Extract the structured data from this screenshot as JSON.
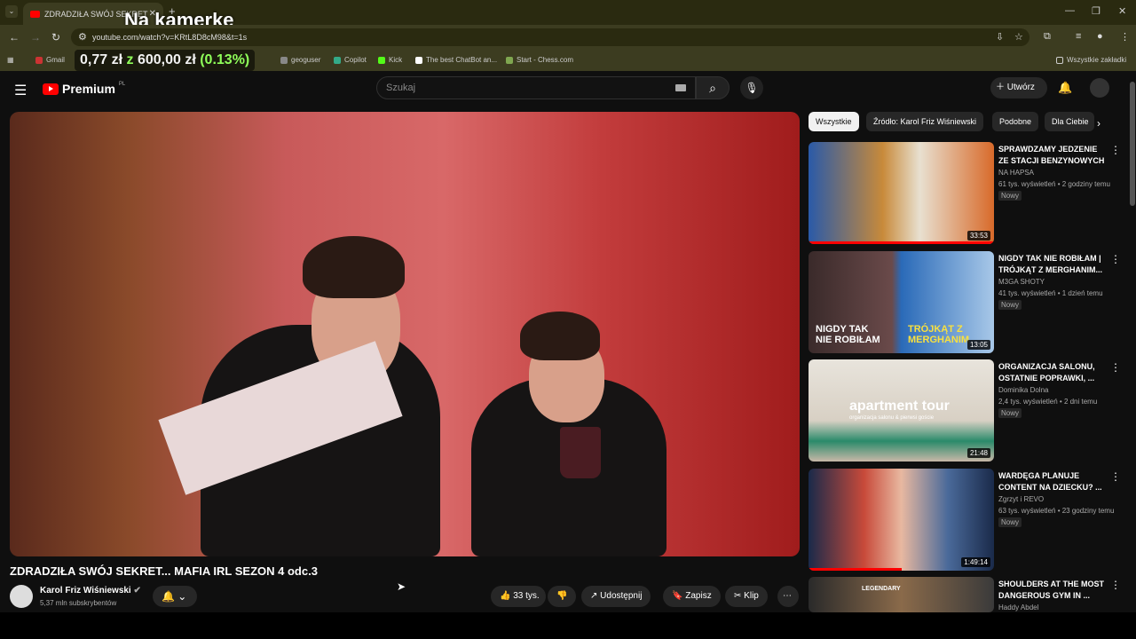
{
  "browser": {
    "tab_title": "ZDRADZIŁA SWÓJ SEKRET",
    "url": "youtube.com/watch?v=KRtL8D8cM98&t=1s",
    "bookmarks": [
      "Gmail",
      "geoguser",
      "Copilot",
      "Kick",
      "The best ChatBot an...",
      "Start - Chess.com"
    ],
    "all_bookmarks": "Wszystkie zakładki"
  },
  "overlay": {
    "title": "Na kamerke",
    "price_a": "0,77 zł",
    "z": "z",
    "price_b": "600,00 zł",
    "pct": "(0.13%)"
  },
  "header": {
    "logo_text": "Premium",
    "logo_cc": "PL",
    "search_placeholder": "Szukaj",
    "create_label": "Utwórz"
  },
  "video": {
    "title": "ZDRADZIŁA SWÓJ SEKRET... MAFIA IRL SEZON 4 odc.3",
    "channel": "Karol Friz Wiśniewski",
    "subs": "5,37 mln subskrybentów",
    "likes": "33 tys.",
    "share": "Udostępnij",
    "save": "Zapisz",
    "clip": "Klip"
  },
  "chips": [
    "Wszystkie",
    "Źródło: Karol Friz Wiśniewski",
    "Podobne",
    "Dla Ciebie"
  ],
  "recommendations": [
    {
      "title": "SPRAWDZAMY JEDZENIE ZE STACJI BENZYNOWYCH",
      "channel": "NA HAPSA",
      "meta": "61 tys. wyświetleń • 2 godziny temu",
      "badge": "Nowy",
      "duration": "33:53"
    },
    {
      "title": "NIGDY TAK NIE ROBIŁAM | TRÓJKĄT Z MERGHANIM...",
      "channel": "M3GA SHOTY",
      "meta": "41 tys. wyświetleń • 1 dzień temu",
      "badge": "Nowy",
      "duration": "13:05"
    },
    {
      "title": "ORGANIZACJA SALONU, OSTATNIE POPRAWKI, ...",
      "channel": "Dominika Dolna",
      "meta": "2,4 tys. wyświetleń • 2 dni temu",
      "badge": "Nowy",
      "duration": "21:48"
    },
    {
      "title": "WARDĘGA PLANUJE CONTENT NA DZIECKU? ...",
      "channel": "Zgrzyt i REVO",
      "meta": "63 tys. wyświetleń • 23 godziny temu",
      "badge": "Nowy",
      "duration": "1:49:14"
    },
    {
      "title": "SHOULDERS AT THE MOST DANGEROUS GYM IN ...",
      "channel": "Haddy Abdel",
      "meta": "",
      "badge": "",
      "duration": ""
    }
  ],
  "thumb_text": {
    "t2_left": "NIGDY TAK NIE ROBIŁAM",
    "t2_right": "TRÓJKĄT Z MERGHANIM",
    "t3": "apartment tour",
    "t3_sub": "organizacja salonu & pierwsi goście",
    "t5": "LEGENDARY"
  }
}
